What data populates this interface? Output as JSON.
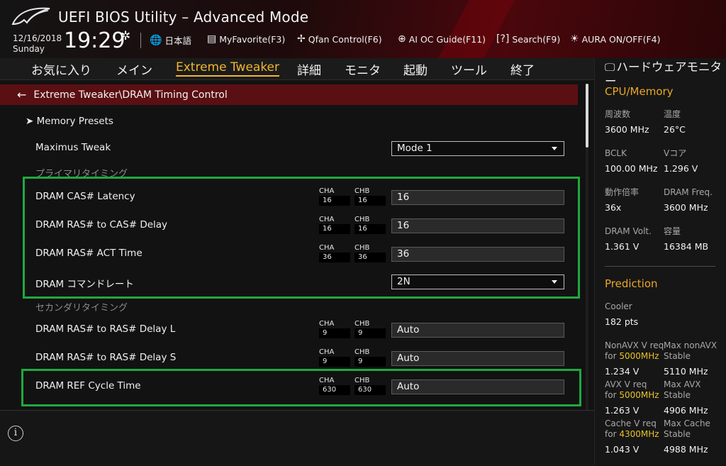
{
  "header": {
    "title": "UEFI BIOS Utility – Advanced Mode",
    "date": "12/16/2018",
    "day": "Sunday",
    "time": "19:29",
    "tools": [
      {
        "icon": "globe-icon",
        "label": "日本語"
      },
      {
        "icon": "favorite-icon",
        "label": "MyFavorite(F3)"
      },
      {
        "icon": "fan-icon",
        "label": "Qfan Control(F6)"
      },
      {
        "icon": "ai-oc-icon",
        "label": "AI OC Guide(F11)"
      },
      {
        "icon": "search-icon",
        "label": "Search(F9)"
      },
      {
        "icon": "aura-icon",
        "label": "AURA ON/OFF(F4)"
      }
    ]
  },
  "menu": {
    "tabs": [
      "お気に入り",
      "メイン",
      "Extreme Tweaker",
      "詳細",
      "モニタ",
      "起動",
      "ツール",
      "終了"
    ],
    "active": "Extreme Tweaker"
  },
  "breadcrumb": "Extreme Tweaker\\DRAM Timing Control",
  "main": {
    "presets": "Memory Presets",
    "maximus_tweak": {
      "label": "Maximus Tweak",
      "value": "Mode 1"
    },
    "primary_section": "プライマリタイミング",
    "secondary_section": "セカンダリタイミング",
    "primary": [
      {
        "label": "DRAM CAS# Latency",
        "cha_label": "CHA",
        "cha": "16",
        "chb_label": "CHB",
        "chb": "16",
        "value": "16"
      },
      {
        "label": "DRAM RAS# to CAS# Delay",
        "cha_label": "CHA",
        "cha": "16",
        "chb_label": "CHB",
        "chb": "16",
        "value": "16"
      },
      {
        "label": "DRAM RAS# ACT Time",
        "cha_label": "CHA",
        "cha": "36",
        "chb_label": "CHB",
        "chb": "36",
        "value": "36"
      }
    ],
    "command_rate": {
      "label": "DRAM コマンドレート",
      "value": "2N"
    },
    "secondary": [
      {
        "label": "DRAM RAS# to RAS# Delay L",
        "cha_label": "CHA",
        "cha": "9",
        "chb_label": "CHB",
        "chb": "9",
        "value": "Auto"
      },
      {
        "label": "DRAM RAS# to RAS# Delay S",
        "cha_label": "CHA",
        "cha": "9",
        "chb_label": "CHB",
        "chb": "9",
        "value": "Auto"
      },
      {
        "label": "DRAM REF Cycle Time",
        "cha_label": "CHA",
        "cha": "630",
        "chb_label": "CHB",
        "chb": "630",
        "value": "Auto"
      }
    ],
    "highlight_color": "#1fa83f"
  },
  "monitor": {
    "title": "ハードウェアモニター",
    "cpu_memory_heading": "CPU/Memory",
    "cpu": [
      {
        "label": "周波数",
        "value": "3600 MHz"
      },
      {
        "label": "温度",
        "value": "26°C"
      },
      {
        "label": "BCLK",
        "value": "100.00 MHz"
      },
      {
        "label": "Vコア",
        "value": "1.296 V"
      },
      {
        "label": "動作倍率",
        "value": "36x"
      },
      {
        "label": "DRAM Freq.",
        "value": "3600 MHz"
      },
      {
        "label": "DRAM Volt.",
        "value": "1.361 V"
      },
      {
        "label": "容量",
        "value": "16384 MB"
      }
    ],
    "prediction_heading": "Prediction",
    "cooler": {
      "label": "Cooler",
      "value": "182 pts"
    },
    "predictions": [
      {
        "label": "NonAVX V req",
        "for": "for",
        "freq": "5000MHz",
        "value": "1.234 V",
        "max_label": "Max nonAVX",
        "max_sub": "Stable",
        "max_value": "5110 MHz"
      },
      {
        "label": "AVX V req",
        "for": "for",
        "freq": "5000MHz",
        "value": "1.263 V",
        "max_label": "Max AVX",
        "max_sub": "Stable",
        "max_value": "4906 MHz"
      },
      {
        "label": "Cache V req",
        "for": "for",
        "freq": "4300MHz",
        "value": "1.043 V",
        "max_label": "Max Cache",
        "max_sub": "Stable",
        "max_value": "4988 MHz"
      }
    ],
    "accent_color": "#e9a825"
  }
}
